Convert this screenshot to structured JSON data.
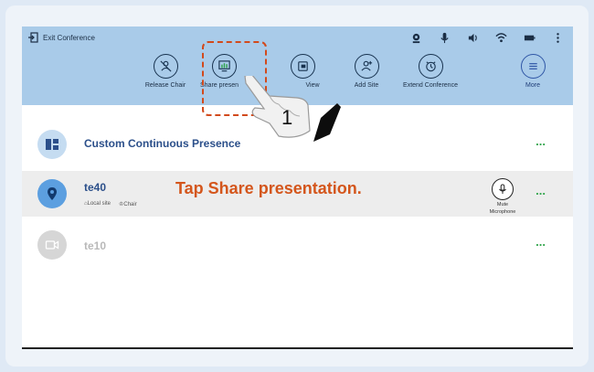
{
  "statusbar": {
    "exit_label": "Exit Conference",
    "icons": [
      "webcam-icon",
      "microphone-icon",
      "speaker-icon",
      "wifi-icon",
      "battery-icon",
      "overflow-menu-icon"
    ]
  },
  "toolbar": {
    "release_chair": "Release Chair",
    "share_presentation": "Share presen",
    "continuous_view": "View",
    "add_site": "Add Site",
    "extend_conference": "Extend Conference",
    "more": "More"
  },
  "rows": [
    {
      "title": "Custom Continuous Presence",
      "actions": "..."
    },
    {
      "title": "te40",
      "sub_local": "Local site",
      "sub_chair": "Chair",
      "mute_label_line1": "Mute",
      "mute_label_line2": "Microphone",
      "actions": "..."
    },
    {
      "title": "te10",
      "actions": "..."
    }
  ],
  "annotation": {
    "callout_text": "Tap Share presentation.",
    "step": "1"
  },
  "colors": {
    "toolbar_bg": "#a9cbe9",
    "callout": "#d4561c",
    "dots": "#31a54b",
    "title": "#2b4f8a"
  }
}
